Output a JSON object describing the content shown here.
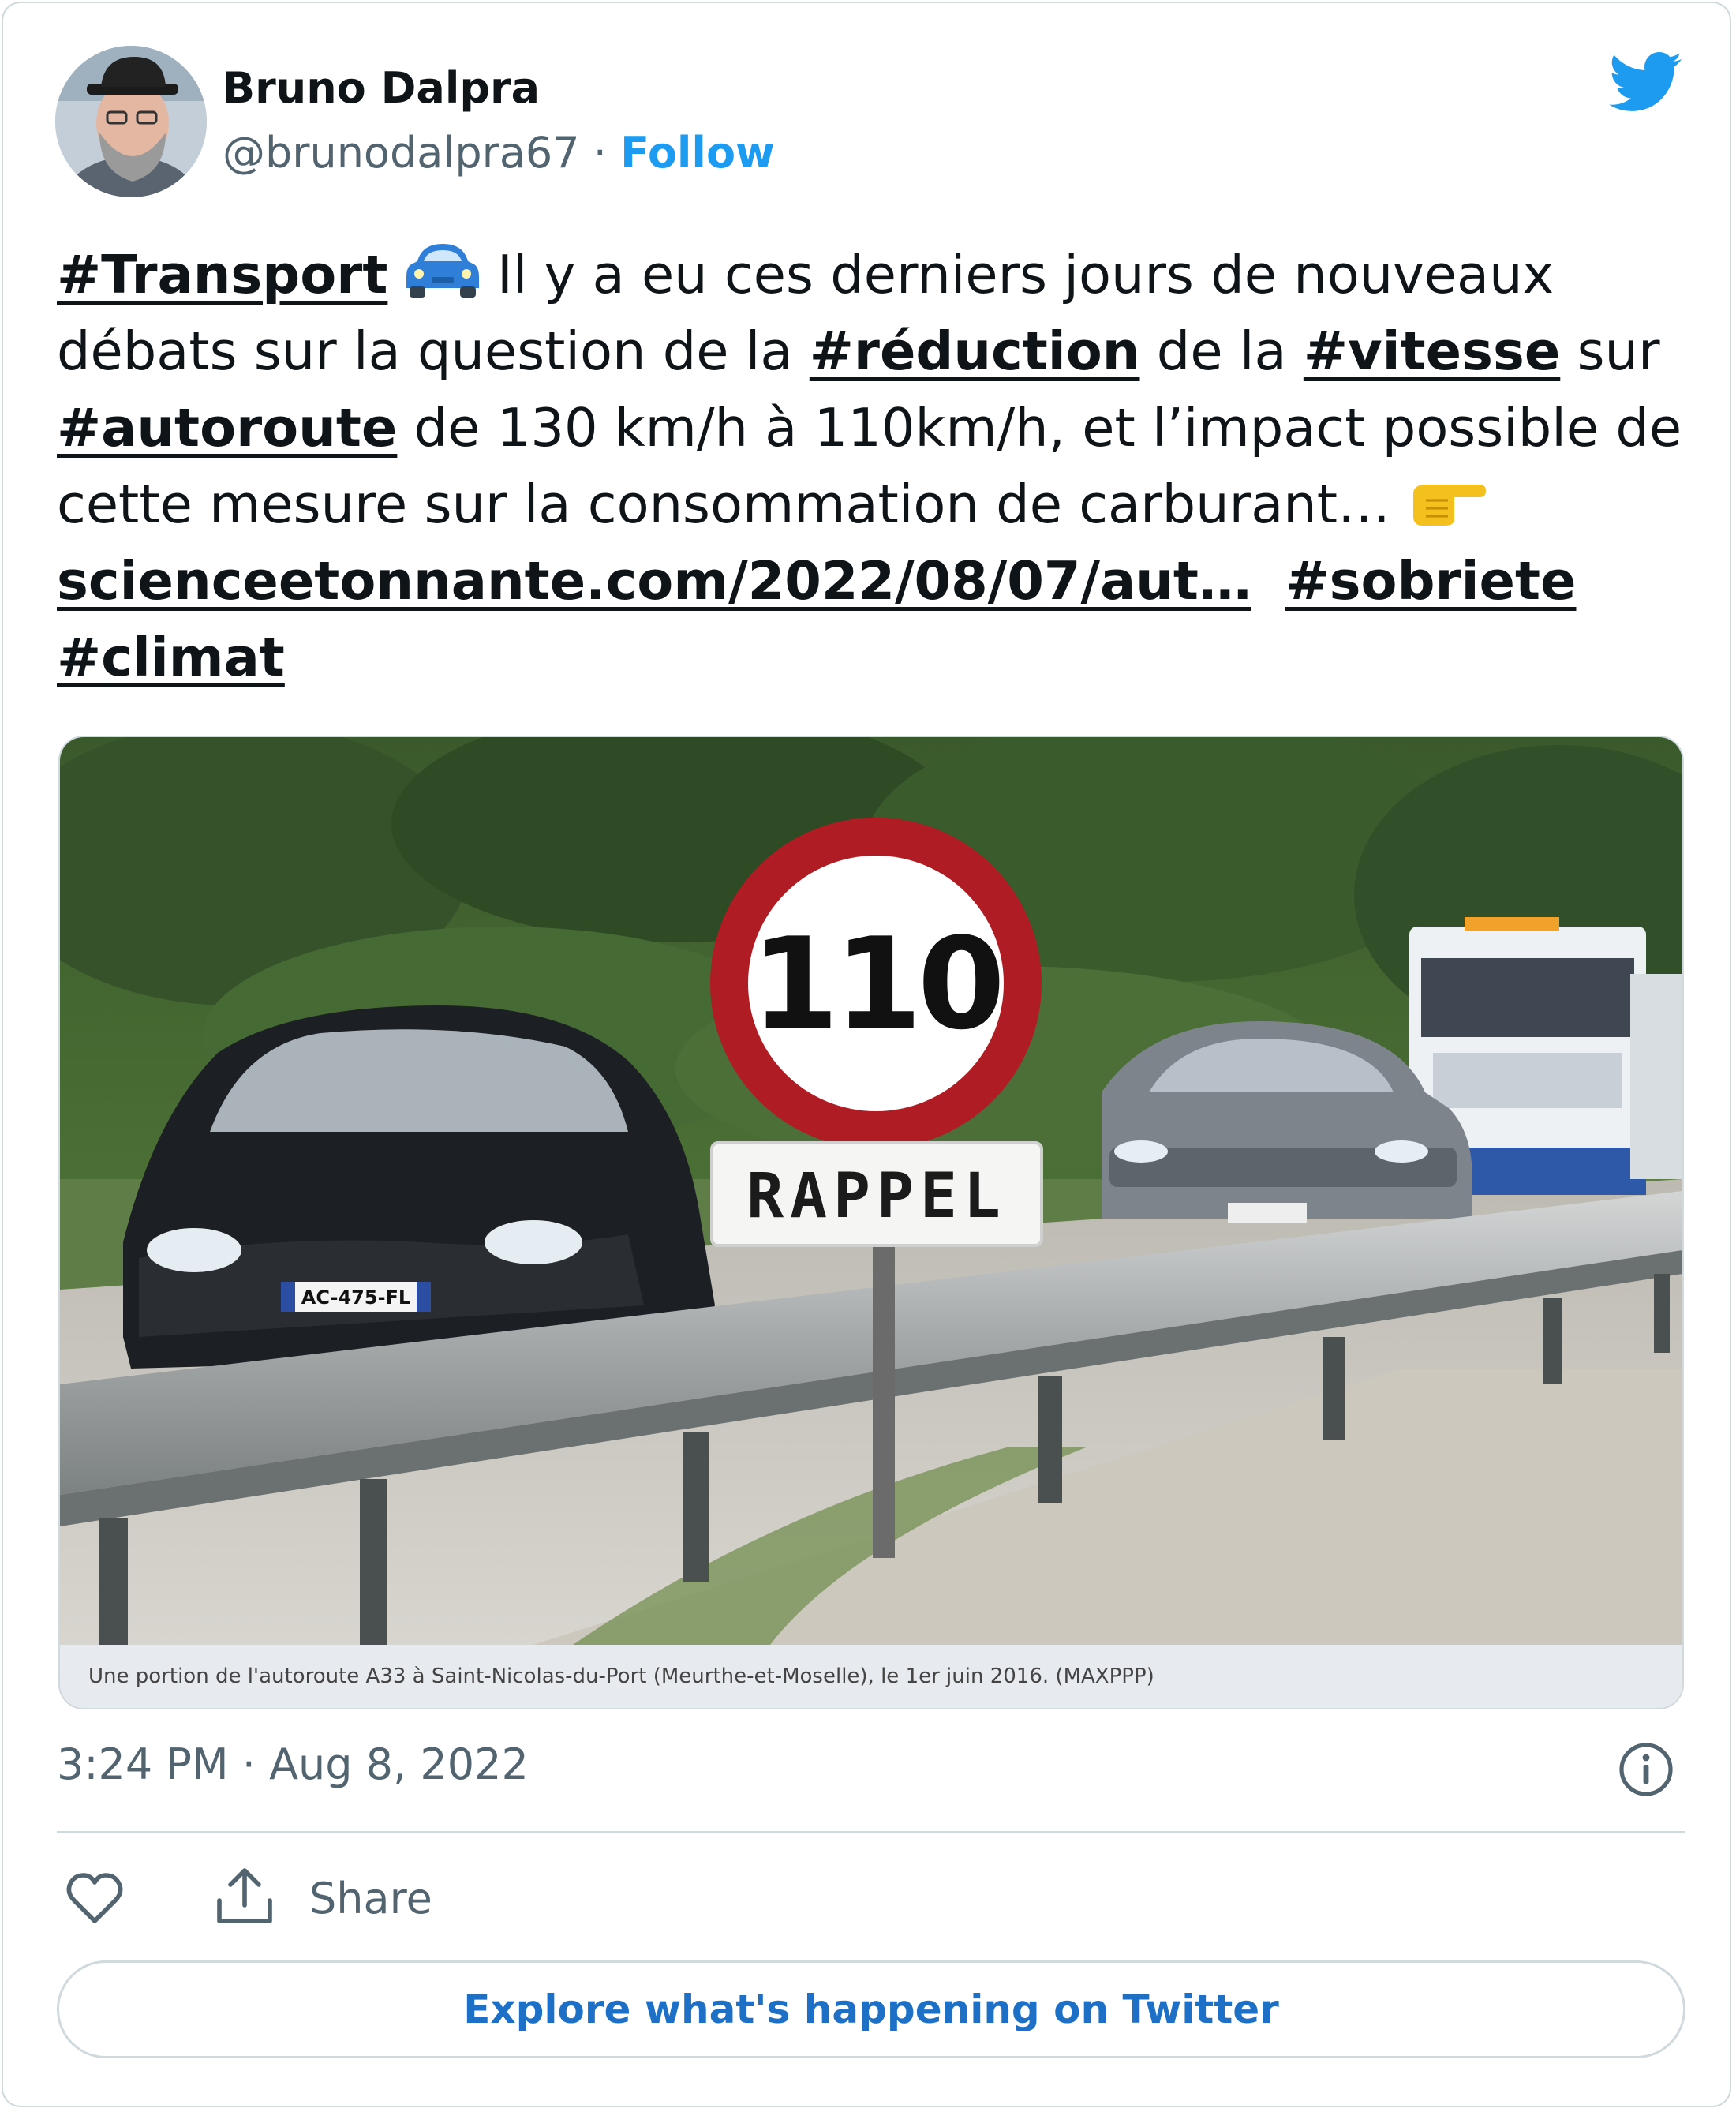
{
  "author": {
    "name": "Bruno Dalpra",
    "handle": "@brunodalpra67",
    "separator": " · ",
    "follow_label": "Follow"
  },
  "tweet": {
    "tag_transport": "#Transport",
    "text_1": " Il y a eu ces derniers jours de nouveaux débats sur la question de la ",
    "tag_reduction": "#réduction",
    "text_2": " de la ",
    "tag_vitesse": "#vitesse",
    "text_3": " sur ",
    "tag_autoroute": "#autoroute",
    "text_4": " de 130 km/h à 110km/h, et l’impact possible de cette mesure sur la consommation de carburant… ",
    "link": "scienceetonnante.com/2022/08/07/aut…",
    "tag_sobriete": "#sobriete",
    "tag_climat": "#climat"
  },
  "media": {
    "sign_number": "110",
    "sign_text": "RAPPEL",
    "plate_left": "AC-475-FL",
    "caption": "Une portion de l'autoroute A33 à Saint-Nicolas-du-Port (Meurthe-et-Moselle), le 1er juin 2016. (MAXPPP)"
  },
  "meta": {
    "timestamp": "3:24 PM · Aug 8, 2022"
  },
  "actions": {
    "share_label": "Share",
    "explore_label": "Explore what's happening on Twitter"
  },
  "colors": {
    "twitter_blue": "#1d9bf0",
    "explore_blue": "#1d70c5",
    "secondary_text": "#536471",
    "border": "#cfd9de",
    "sign_red": "#b01c24"
  },
  "icons": [
    "twitter-bird-icon",
    "car-emoji-icon",
    "pointing-right-emoji-icon",
    "info-icon",
    "heart-icon",
    "share-icon"
  ]
}
